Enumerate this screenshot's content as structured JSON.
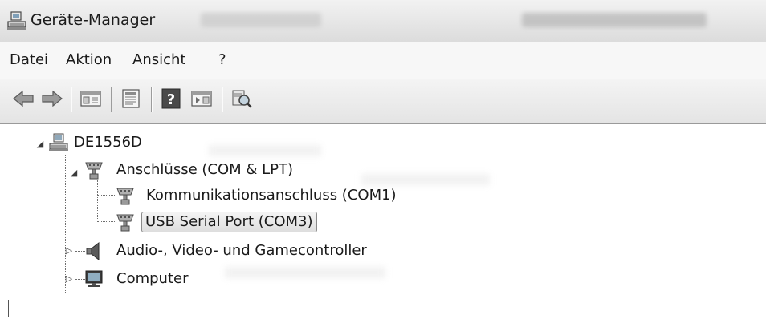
{
  "window": {
    "title": "Geräte-Manager"
  },
  "menu": {
    "items": [
      "Datei",
      "Aktion",
      "Ansicht",
      "?"
    ]
  },
  "toolbar": {
    "buttons": [
      {
        "icon": "back-arrow-icon"
      },
      {
        "icon": "forward-arrow-icon"
      },
      {
        "icon": "show-hide-console-tree-icon"
      },
      {
        "icon": "properties-icon"
      },
      {
        "icon": "help-icon",
        "glyph": "?"
      },
      {
        "icon": "action-pane-icon"
      },
      {
        "icon": "scan-hardware-icon"
      }
    ]
  },
  "tree": {
    "root": {
      "label": "DE1556D",
      "icon": "computer-root-icon",
      "expanded": true
    },
    "ports": {
      "label": "Anschlüsse (COM & LPT)",
      "icon": "port-connector-icon",
      "expanded": true
    },
    "port_com1": {
      "label": "Kommunikationsanschluss (COM1)",
      "icon": "port-connector-icon"
    },
    "port_com3": {
      "label": "USB Serial Port (COM3)",
      "icon": "port-connector-icon",
      "selected": true
    },
    "audio": {
      "label": "Audio-, Video- und Gamecontroller",
      "icon": "speaker-icon",
      "expanded": false
    },
    "computer": {
      "label": "Computer",
      "icon": "monitor-icon",
      "expanded": false
    }
  },
  "colors": {
    "selection_border": "#8a8a8a",
    "background": "#ffffff"
  }
}
